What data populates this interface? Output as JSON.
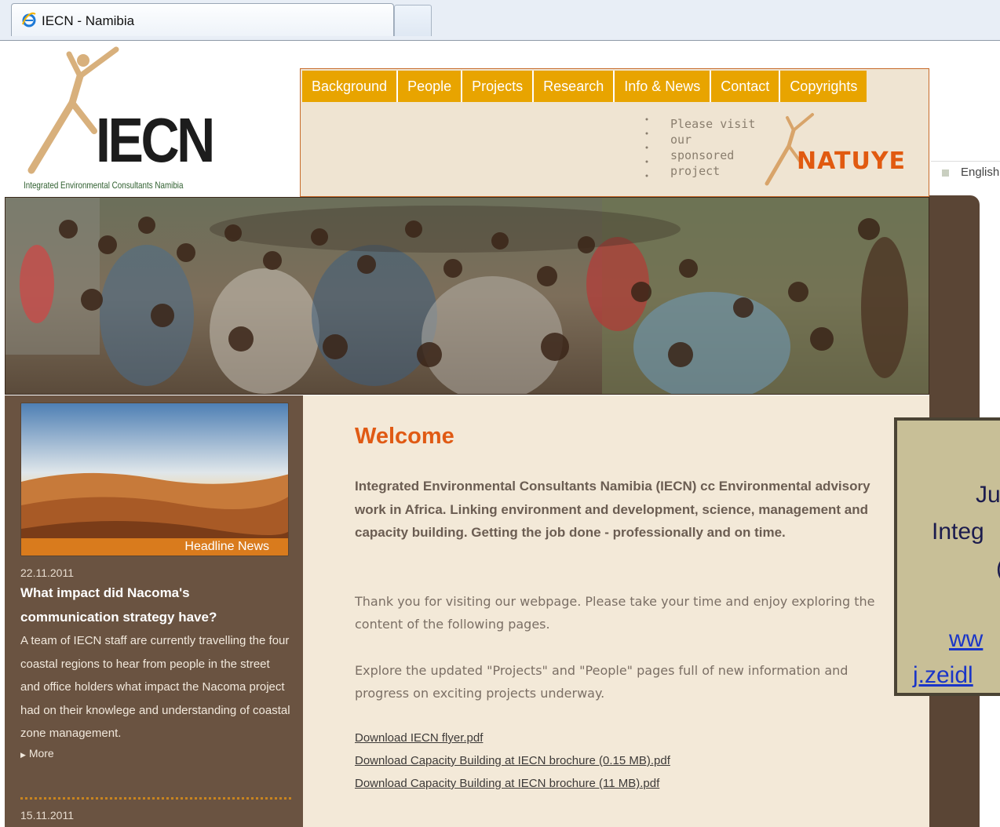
{
  "browser": {
    "tab_title": "IECN - Namibia"
  },
  "logo": {
    "name": "IECN",
    "subtitle": "Integrated Environmental Consultants Namibia"
  },
  "nav": [
    "Background",
    "People",
    "Projects",
    "Research",
    "Info & News",
    "Contact",
    "Copyrights"
  ],
  "promo": {
    "text": "Please visit our sponsored project",
    "logo_text": "NATUYE"
  },
  "language": "English",
  "sidebar": {
    "caption": "Headline News",
    "news": [
      {
        "date": "22.11.2011",
        "title": "What impact did Nacoma's communication strategy have?",
        "body": "A team of IECN staff are currently travelling the four coastal regions to hear from people in the street and office holders what impact the Nacoma project had on their knowlege and understanding of coastal zone management.",
        "more": "More"
      },
      {
        "date": "15.11.2011"
      }
    ]
  },
  "main": {
    "heading": "Welcome",
    "intro": "Integrated Environmental Consultants Namibia (IECN) cc Environmental advisory work in Africa. Linking environment and development, science, management and capacity building. Getting the job done - professionally and on time.",
    "para1": "Thank you for visiting our webpage. Please take your time and enjoy exploring the content of the following pages.",
    "para2": "Explore the updated \"Projects\" and \"People\" pages full of new information and progress on exciting projects underway.",
    "downloads": [
      "Download IECN flyer.pdf",
      "Download Capacity Building at IECN brochure (0.15 MB).pdf",
      "Download Capacity Building at IECN brochure (11 MB).pdf"
    ]
  },
  "popup": {
    "line1": "Ju",
    "line2": "Integ",
    "line3": "(",
    "link1": "ww",
    "link2": "j.zeidl"
  },
  "colors": {
    "nav_bg": "#e8a400",
    "heading": "#e05a14",
    "sidebar_bg": "#6a5341",
    "main_bg": "#f3e9d8",
    "popup_bg": "#c8bf97"
  }
}
